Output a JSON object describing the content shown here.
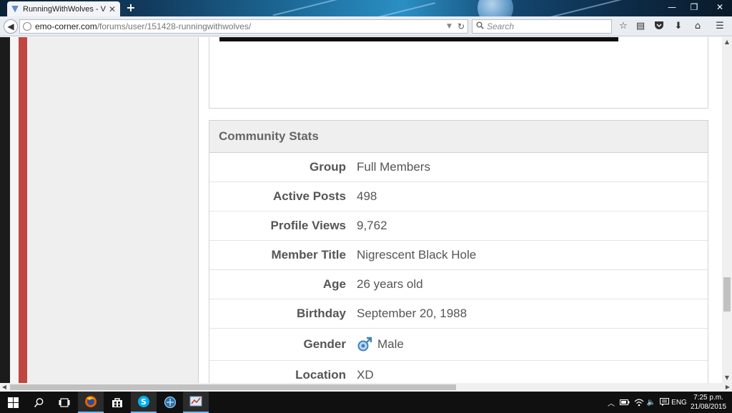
{
  "browser": {
    "tab_title": "RunningWithWolves - Vie...",
    "new_tab": "+",
    "url_domain": "emo-corner.com",
    "url_path": "/forums/user/151428-runningwithwolves/",
    "search_placeholder": "Search",
    "icons": [
      "back-icon",
      "reload-icon",
      "search-icon",
      "bookmark-star-icon",
      "reading-list-icon",
      "pocket-icon",
      "download-icon",
      "home-icon",
      "menu-icon"
    ],
    "window_controls": [
      "minimize-icon",
      "restore-icon",
      "close-icon"
    ]
  },
  "community_stats": {
    "heading": "Community Stats",
    "rows": [
      {
        "label": "Group",
        "value": "Full Members"
      },
      {
        "label": "Active Posts",
        "value": "498"
      },
      {
        "label": "Profile Views",
        "value": "9,762"
      },
      {
        "label": "Member Title",
        "value": "Nigrescent Black Hole"
      },
      {
        "label": "Age",
        "value": "26 years old"
      },
      {
        "label": "Birthday",
        "value": "September 20, 1988"
      },
      {
        "label": "Gender",
        "value": "Male",
        "icon": "male-gender-icon"
      },
      {
        "label": "Location",
        "value": "XD"
      }
    ]
  },
  "taskbar": {
    "apps": [
      "windows-start-icon",
      "search-icon",
      "task-view-icon",
      "firefox-icon",
      "store-icon",
      "skype-icon",
      "app-icon",
      "app-icon-2"
    ],
    "tray": [
      "chevron-up-icon",
      "battery-icon",
      "wifi-icon",
      "volume-icon",
      "notification-icon"
    ],
    "language": "ENG",
    "time": "7:25 p.m.",
    "date": "21/08/2015"
  },
  "colors": {
    "sidebar_accent": "#c0473f",
    "text": "#555555",
    "heading": "#666666",
    "panel_header": "#efefef"
  }
}
